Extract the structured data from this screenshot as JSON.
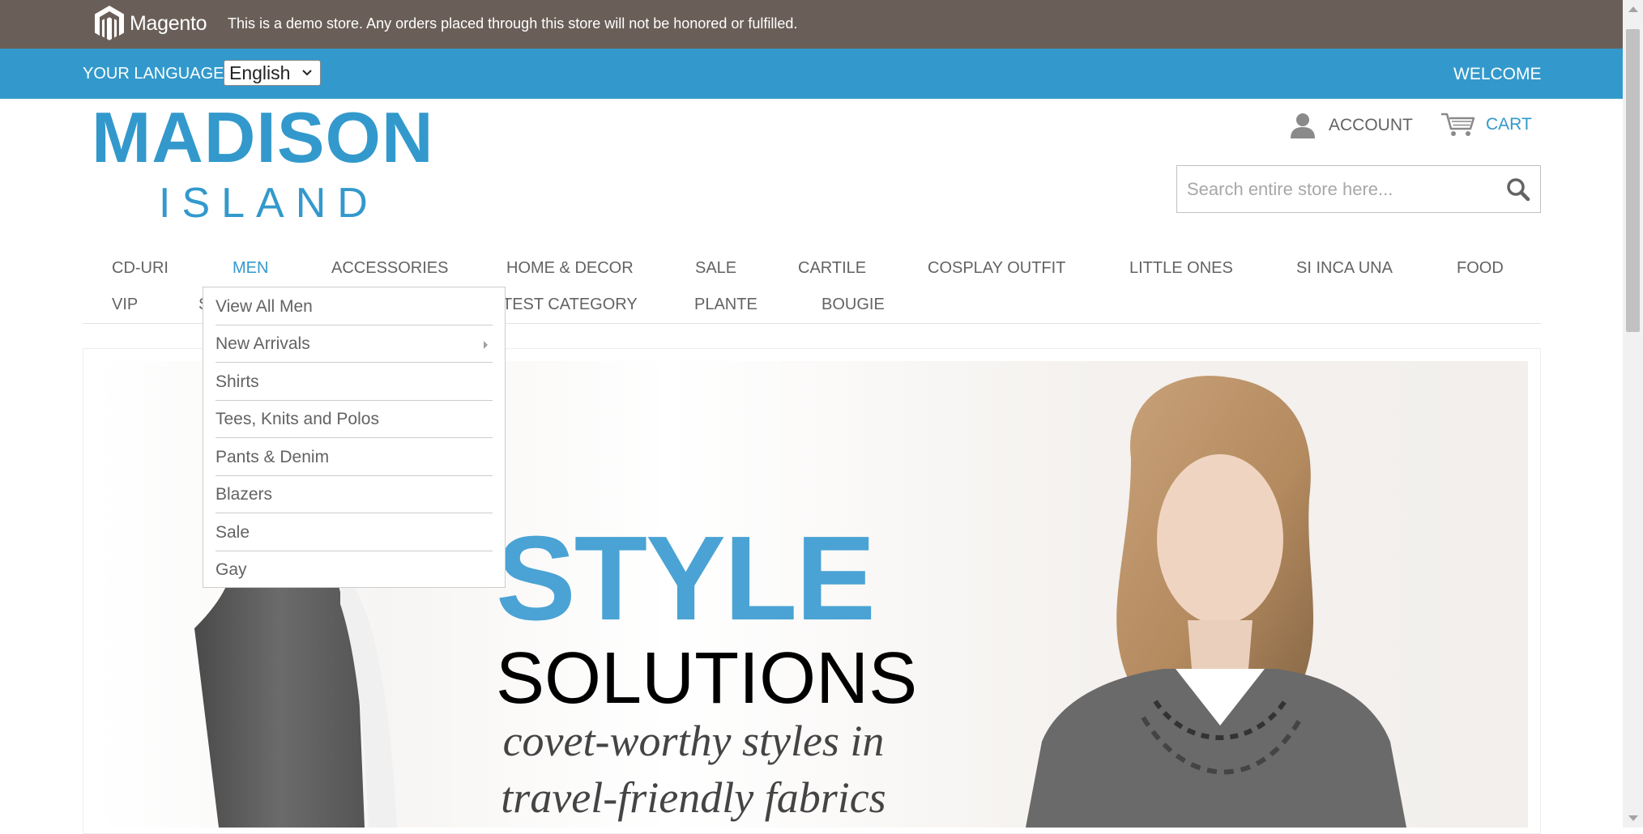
{
  "demo_notice": {
    "brand": "Magento",
    "text": "This is a demo store. Any orders placed through this store will not be honored or fulfilled."
  },
  "language_bar": {
    "label": "YOUR LANGUAGE:",
    "selected": "English",
    "welcome": "WELCOME"
  },
  "header": {
    "logo_line1": "MADISON",
    "logo_line2": "ISLAND",
    "account_label": "ACCOUNT",
    "cart_label": "CART",
    "search_placeholder": "Search entire store here..."
  },
  "nav": {
    "row1": [
      "CD-URI",
      "MEN",
      "ACCESSORIES",
      "HOME & DECOR",
      "SALE",
      "CARTILE",
      "COSPLAY OUTFIT",
      "LITTLE ONES",
      "SI INCA UNA",
      "FOOD"
    ],
    "row2": [
      "VIP",
      "S",
      "TEST CATEGORY",
      "PLANTE",
      "BOUGIE"
    ],
    "active": "MEN"
  },
  "men_dropdown": {
    "items": [
      "View All Men",
      "New Arrivals",
      "Shirts",
      "Tees, Knits and Polos",
      "Pants & Denim",
      "Blazers",
      "Sale",
      "Gay"
    ]
  },
  "hero": {
    "title": "STYLE",
    "subtitle": "SOLUTIONS",
    "tagline_line1": "covet-worthy styles in",
    "tagline_line2": "travel-friendly fabrics"
  },
  "colors": {
    "demo_bar": "#6a5f58",
    "accent": "#3399cc",
    "text": "#636363"
  }
}
